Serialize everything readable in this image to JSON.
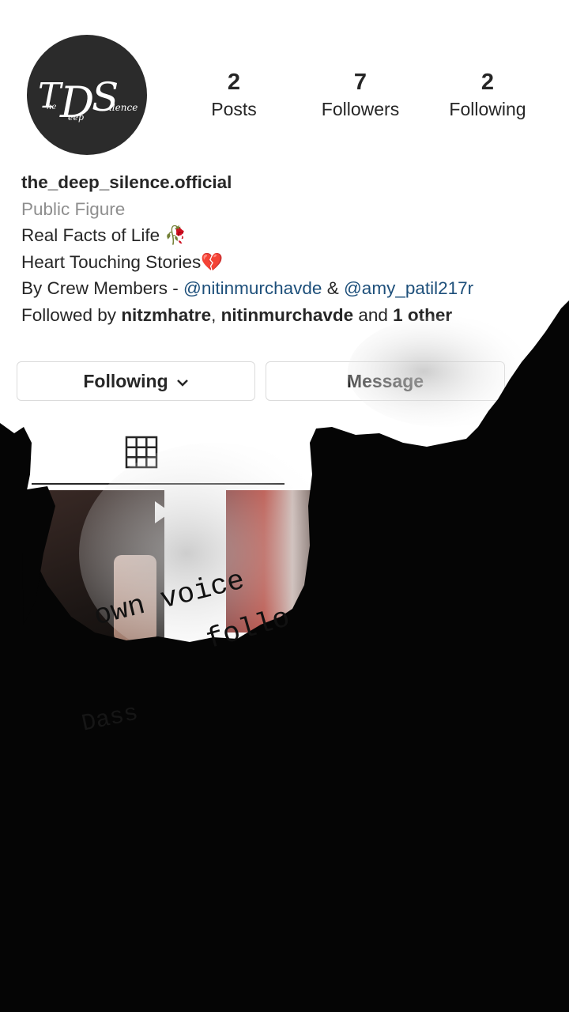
{
  "profile": {
    "avatar_text": "TDS The Deep Silence",
    "stats": [
      {
        "count": "2",
        "label": "Posts"
      },
      {
        "count": "7",
        "label": "Followers"
      },
      {
        "count": "2",
        "label": "Following"
      }
    ],
    "username": "the_deep_silence.official",
    "category": "Public Figure",
    "bio_line1": "Real Facts of Life 🥀",
    "bio_line2": "Heart Touching Stories💔",
    "bio_line3_prefix": "By Crew Members - ",
    "mention1": "@nitinmurchavde",
    "bio_line3_mid": " & ",
    "mention2": "@amy_patil217r",
    "followed_prefix": "Followed by ",
    "followed_user1": "nitzmhatre",
    "followed_sep": ", ",
    "followed_user2": "nitinmurchavde",
    "followed_and": " and ",
    "followed_others": "1 other"
  },
  "actions": {
    "following_label": "Following",
    "message_label": "Message"
  },
  "overlay_text": {
    "line1": "own voice",
    "line2": "follo",
    "line3": "Dass"
  },
  "colors": {
    "mention": "#1d4f7a",
    "muted": "#8e8e8e",
    "ink": "#262626"
  }
}
